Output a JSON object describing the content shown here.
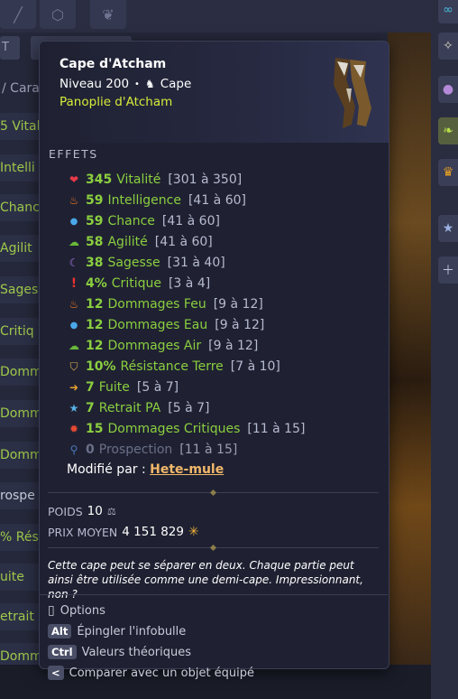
{
  "background": {
    "side_items": [
      "5 Vital",
      "Intelli",
      "Chanc",
      "Agilit",
      "Sages",
      "Critiq",
      "Domm",
      "Domm",
      "Domm",
      "rospe",
      "% Rési",
      "uite",
      "etrait",
      "Domm"
    ],
    "breadcrumb": "/ Cara"
  },
  "tooltip": {
    "item_name": "Cape d'Atcham",
    "level_label": "Niveau 200",
    "separator": "•",
    "item_type": "Cape",
    "set_name": "Panoplie d'Atcham",
    "effects_title": "EFFETS",
    "effects": [
      {
        "icon": "heart-icon",
        "value": "345",
        "name": "Vitalité",
        "range": "[301 à 350]"
      },
      {
        "icon": "fire-icon",
        "value": "59",
        "name": "Intelligence",
        "range": "[41 à 60]"
      },
      {
        "icon": "water-drop-icon",
        "value": "59",
        "name": "Chance",
        "range": "[41 à 60]"
      },
      {
        "icon": "earth-icon",
        "value": "58",
        "name": "Agilité",
        "range": "[41 à 60]"
      },
      {
        "icon": "moon-icon",
        "value": "38",
        "name": "Sagesse",
        "range": "[31 à 40]"
      },
      {
        "icon": "exclamation-icon",
        "value": "4%",
        "name": "Critique",
        "range": "[3 à 4]"
      },
      {
        "icon": "fire-icon",
        "value": "12",
        "name": "Dommages Feu",
        "range": "[9 à 12]"
      },
      {
        "icon": "water-drop-icon",
        "value": "12",
        "name": "Dommages Eau",
        "range": "[9 à 12]"
      },
      {
        "icon": "earth-icon",
        "value": "12",
        "name": "Dommages Air",
        "range": "[9 à 12]"
      },
      {
        "icon": "shield-icon",
        "value": "10%",
        "name": "Résistance Terre",
        "range": "[7 à 10]"
      },
      {
        "icon": "exit-arrow-icon",
        "value": "7",
        "name": "Fuite",
        "range": "[5 à 7]"
      },
      {
        "icon": "star-icon",
        "value": "7",
        "name": "Retrait PA",
        "range": "[5 à 7]"
      },
      {
        "icon": "critical-damage-icon",
        "value": "15",
        "name": "Dommages Critiques",
        "range": "[11 à 15]"
      },
      {
        "icon": "magnifier-icon",
        "value": "0",
        "name": "Prospection",
        "range": "[11 à 15]",
        "muted": true
      }
    ],
    "modified_label": "Modifié par :",
    "modified_by": "Hete-mule",
    "weight_label": "POIDS",
    "weight_value": "10",
    "price_label": "PRIX MOYEN",
    "price_value": "4 151 829",
    "description": "Cette cape peut se séparer en deux. Chaque partie peut ainsi être utilisée comme une demi-cape. Impressionnant, non ?",
    "hints": [
      {
        "key": "mouse-icon",
        "label": "Options"
      },
      {
        "key": "Alt",
        "label": "Épingler l'infobulle"
      },
      {
        "key": "Ctrl",
        "label": "Valeurs théoriques"
      },
      {
        "key": "<",
        "label": "Comparer avec un objet équipé"
      }
    ]
  },
  "colors": {
    "effect_green": "#8bcf3f",
    "set_yellow": "#d6ec3a",
    "link_orange": "#f2b86a",
    "tooltip_bg": "#1f2132"
  }
}
